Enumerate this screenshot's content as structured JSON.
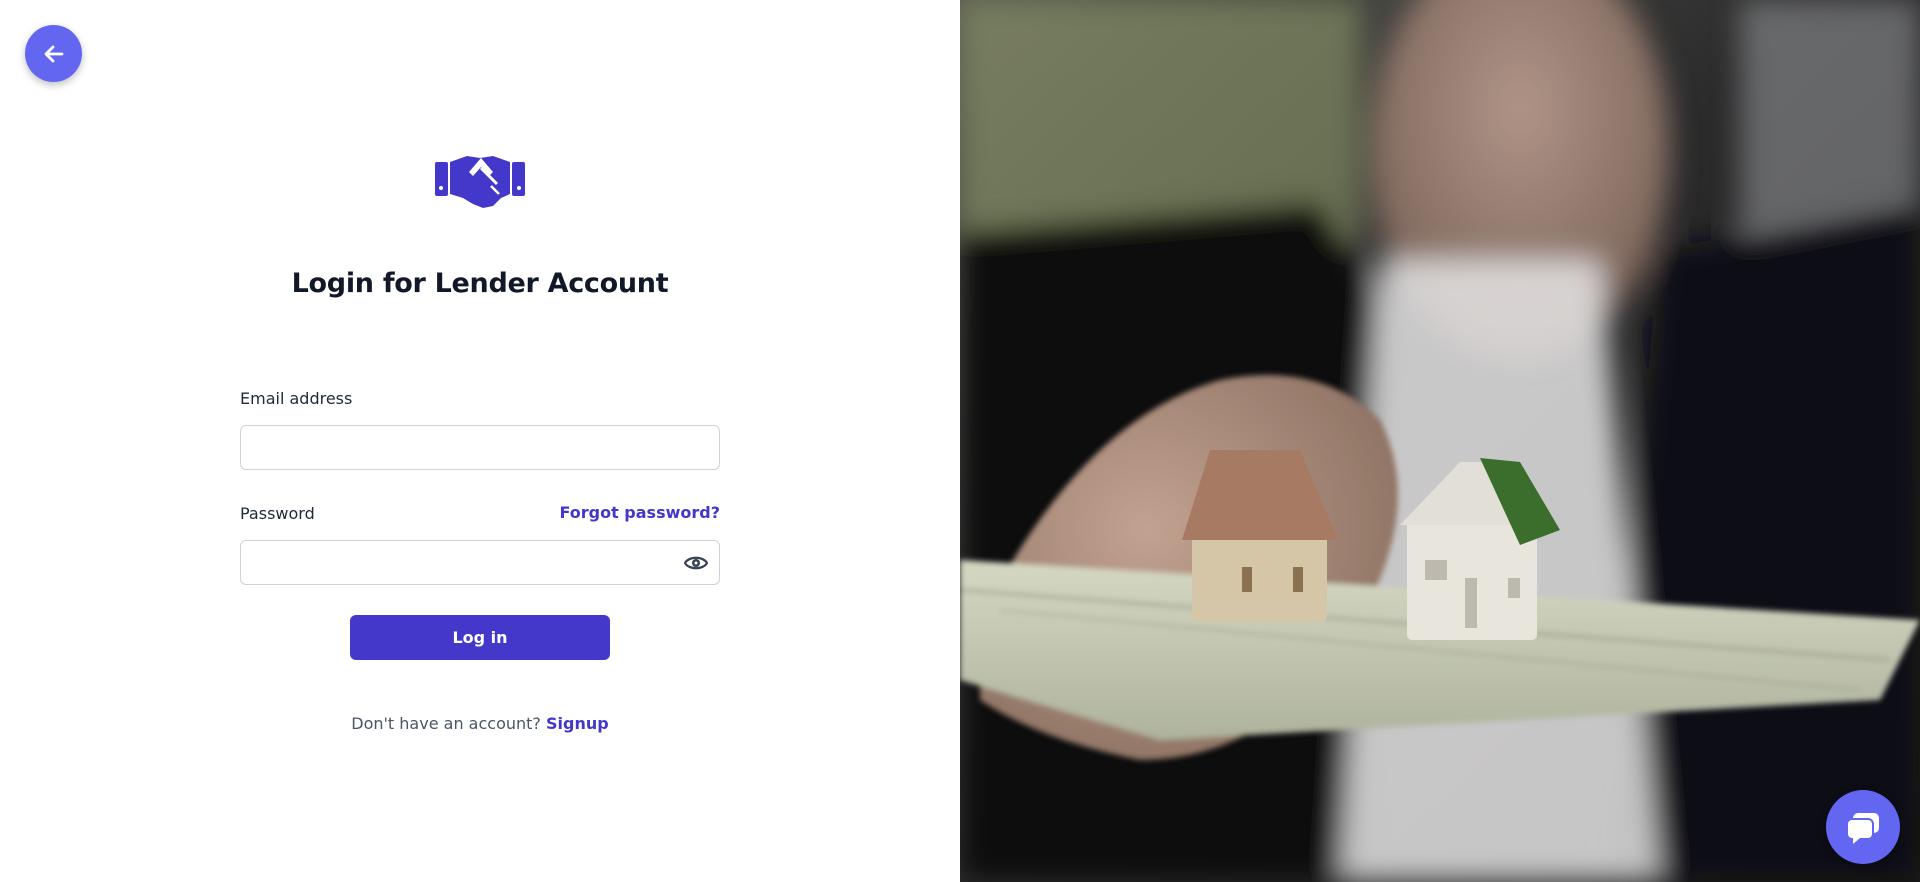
{
  "nav": {
    "back_icon": "arrow-left-icon"
  },
  "brand": {
    "logo_icon": "handshake-icon",
    "accent_color": "#4338ca"
  },
  "login": {
    "title": "Login for Lender Account",
    "email_label": "Email address",
    "email_value": "",
    "password_label": "Password",
    "password_value": "",
    "forgot_label": "Forgot password?",
    "toggle_icon": "eye-icon",
    "submit_label": "Log in",
    "signup_prompt": "Don't have an account?",
    "signup_link": "Signup"
  },
  "support": {
    "chat_icon": "chat-bubble-icon"
  }
}
